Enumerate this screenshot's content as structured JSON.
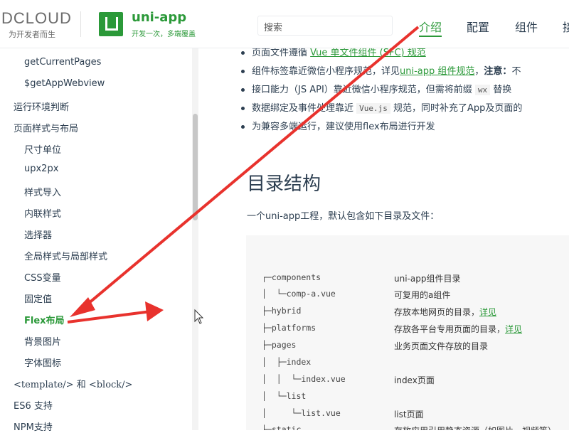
{
  "header": {
    "dcloud_name": "DCLOUD",
    "dcloud_slogan": "为开发者而生",
    "app_name": "uni-app",
    "app_slogan": "开发一次，多端覆盖",
    "search_placeholder": "搜索",
    "nav": [
      "介绍",
      "配置",
      "组件",
      "接"
    ],
    "accent": "#2b9939"
  },
  "sidebar": {
    "items": [
      {
        "label": "getCurrentPages",
        "level": 2
      },
      {
        "label": "$getAppWebview",
        "level": 2
      },
      {
        "label": "运行环境判断",
        "level": 1
      },
      {
        "label": "页面样式与布局",
        "level": 1
      },
      {
        "label": "尺寸单位",
        "level": 2
      },
      {
        "label": "upx2px",
        "level": 2
      },
      {
        "label": "样式导入",
        "level": 2
      },
      {
        "label": "内联样式",
        "level": 2
      },
      {
        "label": "选择器",
        "level": 2
      },
      {
        "label": "全局样式与局部样式",
        "level": 2
      },
      {
        "label": "CSS变量",
        "level": 2
      },
      {
        "label": "固定值",
        "level": 2
      },
      {
        "label": "Flex布局",
        "level": 2,
        "active": true
      },
      {
        "label": "背景图片",
        "level": 2
      },
      {
        "label": "字体图标",
        "level": 2
      },
      {
        "label": "<template/> 和 <block/>",
        "level": 1
      },
      {
        "label": "ES6 支持",
        "level": 1
      },
      {
        "label": "NPM支持",
        "level": 1
      }
    ]
  },
  "content": {
    "bullets": [
      {
        "pre": "页面文件遵循 ",
        "link": "Vue 单文件组件 (SFC) 规范",
        "post": ""
      },
      {
        "pre": "组件标签靠近微信小程序规范，详见",
        "link": "uni-app 组件规范",
        "post": "，",
        "bold": "注意：",
        "tail": "不"
      },
      {
        "pre": "接口能力（JS API）靠近微信小程序规范，但需将前缀 ",
        "code": "wx",
        "post": " 替换"
      },
      {
        "pre": "数据绑定及事件处理靠近 ",
        "code": "Vue.js",
        "post": " 规范，同时补充了App及页面的"
      },
      {
        "pre": "为兼容多端运行，建议使用flex布局进行开发"
      }
    ],
    "heading": "目录结构",
    "intro": "一个uni-app工程，默认包含如下目录及文件：",
    "tree": [
      {
        "path": "┌─components",
        "desc": "uni-app组件目录"
      },
      {
        "path": "│  └─comp-a.vue",
        "desc": "可复用的a组件"
      },
      {
        "path": "├─hybrid",
        "desc": "存放本地网页的目录，",
        "link": "详见"
      },
      {
        "path": "├─platforms",
        "desc": "存放各平台专用页面的目录，",
        "link": "详见"
      },
      {
        "path": "├─pages",
        "desc": "业务页面文件存放的目录"
      },
      {
        "path": "│  ├─index",
        "desc": ""
      },
      {
        "path": "│  │  └─index.vue",
        "desc": "index页面"
      },
      {
        "path": "│  └─list",
        "desc": ""
      },
      {
        "path": "│     └─list.vue",
        "desc": "list页面"
      },
      {
        "path": "├─static",
        "desc": "存放应用引用静态资源（如图片、视频等）"
      }
    ]
  },
  "annotation": {
    "arrow_color": "#e8322d"
  }
}
